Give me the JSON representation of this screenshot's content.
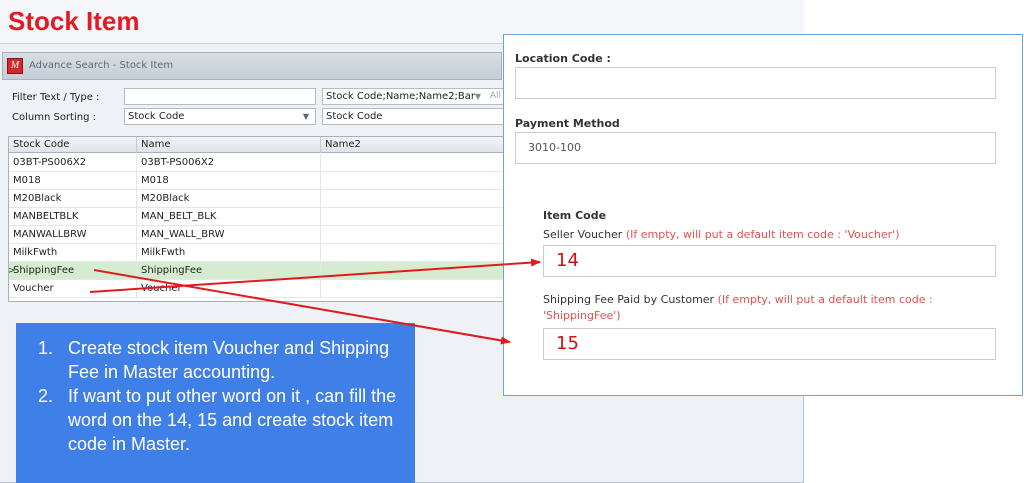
{
  "window": {
    "title": "Stock Item",
    "search_title": "Advance Search - Stock Item",
    "app_logo": "M"
  },
  "filter": {
    "filter_label": "Filter Text / Type :",
    "filter_value": "",
    "column_sorting_label": "Column Sorting :",
    "column_sorting_value": "Stock Code",
    "columns_value": "Stock Code;Name;Name2;Bar",
    "columns_extra": "All",
    "order_value": "Stock Code"
  },
  "grid": {
    "headers": [
      "Stock Code",
      "Name",
      "Name2"
    ],
    "rows": [
      {
        "code": "03BT-PS006X2",
        "name": "03BT-PS006X2",
        "name2": ""
      },
      {
        "code": "M018",
        "name": "M018",
        "name2": ""
      },
      {
        "code": "M20Black",
        "name": "M20Black",
        "name2": ""
      },
      {
        "code": "MANBELTBLK",
        "name": "MAN_BELT_BLK",
        "name2": ""
      },
      {
        "code": "MANWALLBRW",
        "name": "MAN_WALL_BRW",
        "name2": ""
      },
      {
        "code": "MilkFwth",
        "name": "MilkFwth",
        "name2": ""
      },
      {
        "code": "ShippingFee",
        "name": "ShippingFee",
        "name2": ""
      },
      {
        "code": "Voucher",
        "name": "Voucher",
        "name2": ""
      }
    ],
    "selected_row_index": 6
  },
  "note": {
    "items": [
      {
        "num": "1.",
        "text": "Create stock item Voucher and Shipping Fee in Master accounting."
      },
      {
        "num": "2.",
        "text": "If want to put other word on it , can fill the word on the 14, 15 and create stock item code in Master."
      }
    ]
  },
  "settings": {
    "location_code_label": "Location Code :",
    "location_code_value": "",
    "payment_method_label": "Payment Method",
    "payment_method_value": "3010-100",
    "item_code_label": "Item Code",
    "seller_voucher_label": "Seller Voucher",
    "seller_voucher_hint": "(If empty, will put a default item code : 'Voucher')",
    "seller_voucher_value": "14",
    "shipping_fee_label": "Shipping Fee Paid by Customer",
    "shipping_fee_hint": "(If empty, will put a default item code : 'ShippingFee')",
    "shipping_fee_value": "15"
  },
  "colors": {
    "title_red": "#e21b23",
    "note_blue": "#3f7fe8",
    "hint_red": "#e0524d",
    "arrow_red": "#e01b1b",
    "selected_row_green": "#d6ecd0"
  }
}
